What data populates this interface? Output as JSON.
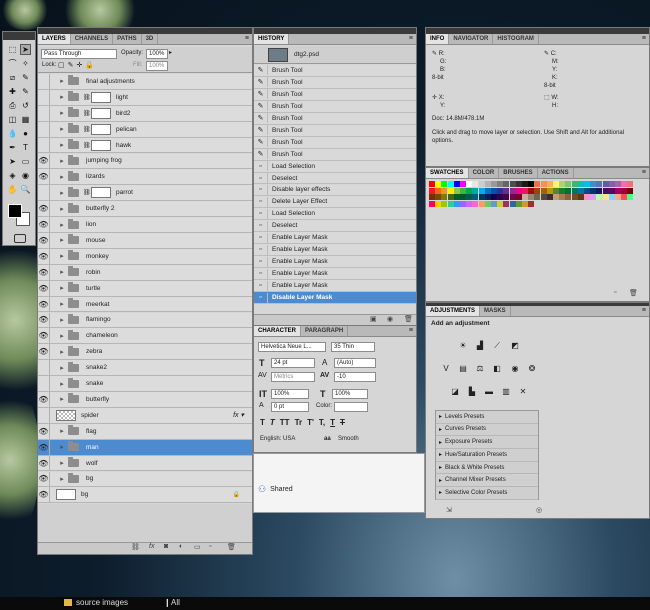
{
  "layers": {
    "tabs": [
      "LAYERS",
      "CHANNELS",
      "PATHS",
      "3D"
    ],
    "blend_mode": "Pass Through",
    "opacity_label": "Opacity:",
    "opacity": "100%",
    "lock_label": "Lock:",
    "fill_label": "Fill:",
    "fill": "100%",
    "items": [
      "final adjustments",
      "light",
      "bird2",
      "pelican",
      "hawk",
      "jumping frog",
      "lizards",
      "parrot",
      "butterfly 2",
      "lion",
      "mouse",
      "monkey",
      "robin",
      "turtle",
      "meerkat",
      "flamingo",
      "chameleon",
      "zebra",
      "snake2",
      "snake",
      "butterfly",
      "spider",
      "flag",
      "man",
      "wolf",
      "bg",
      "bg"
    ],
    "fx": "fx"
  },
  "history": {
    "tab": "HISTORY",
    "snapshot": "dtg2.psd",
    "items": [
      "Brush Tool",
      "Brush Tool",
      "Brush Tool",
      "Brush Tool",
      "Brush Tool",
      "Brush Tool",
      "Brush Tool",
      "Brush Tool",
      "Load Selection",
      "Deselect",
      "Disable layer effects",
      "Delete Layer Effect",
      "Load Selection",
      "Deselect",
      "Enable Layer Mask",
      "Enable Layer Mask",
      "Enable Layer Mask",
      "Enable Layer Mask",
      "Enable Layer Mask",
      "Disable Layer Mask"
    ]
  },
  "character": {
    "tabs": [
      "CHARACTER",
      "PARAGRAPH"
    ],
    "font": "Helvetica Neue L...",
    "style": "35 Thin",
    "size": "24 pt",
    "leading": "(Auto)",
    "kerning": "Metrics",
    "tracking": "-10",
    "vscale": "100%",
    "hscale": "100%",
    "baseline": "0 pt",
    "color_label": "Color:",
    "typo": [
      "T",
      "T",
      "TT",
      "Tr",
      "T'",
      "T,",
      "T",
      "T"
    ],
    "language": "English: USA",
    "aa_label": "aa",
    "antialias": "Smooth"
  },
  "info": {
    "tabs": [
      "INFO",
      "NAVIGATOR",
      "HISTOGRAM"
    ],
    "r": "R:",
    "g": "G:",
    "b": "B:",
    "c": "C:",
    "m": "M:",
    "y": "Y:",
    "k": "K:",
    "bit1": "8-bit",
    "bit2": "8-bit",
    "x": "X:",
    "yy": "Y:",
    "w": "W:",
    "h": "H:",
    "doc": "Doc: 14.8M/478.1M",
    "hint": "Click and drag to move layer or selection.  Use Shift and Alt for additional options."
  },
  "swatches": {
    "tabs": [
      "SWATCHES",
      "COLOR",
      "BRUSHES",
      "ACTIONS"
    ]
  },
  "adjustments": {
    "tabs": [
      "ADJUSTMENTS",
      "MASKS"
    ],
    "heading": "Add an adjustment",
    "presets": [
      "Levels Presets",
      "Curves Presets",
      "Exposure Presets",
      "Hue/Saturation Presets",
      "Black & White Presets",
      "Channel Mixer Presets",
      "Selective Color Presets"
    ]
  },
  "desktop": {
    "shared": "Shared",
    "taskbar_folder": "source images",
    "taskbar_all": "All"
  }
}
